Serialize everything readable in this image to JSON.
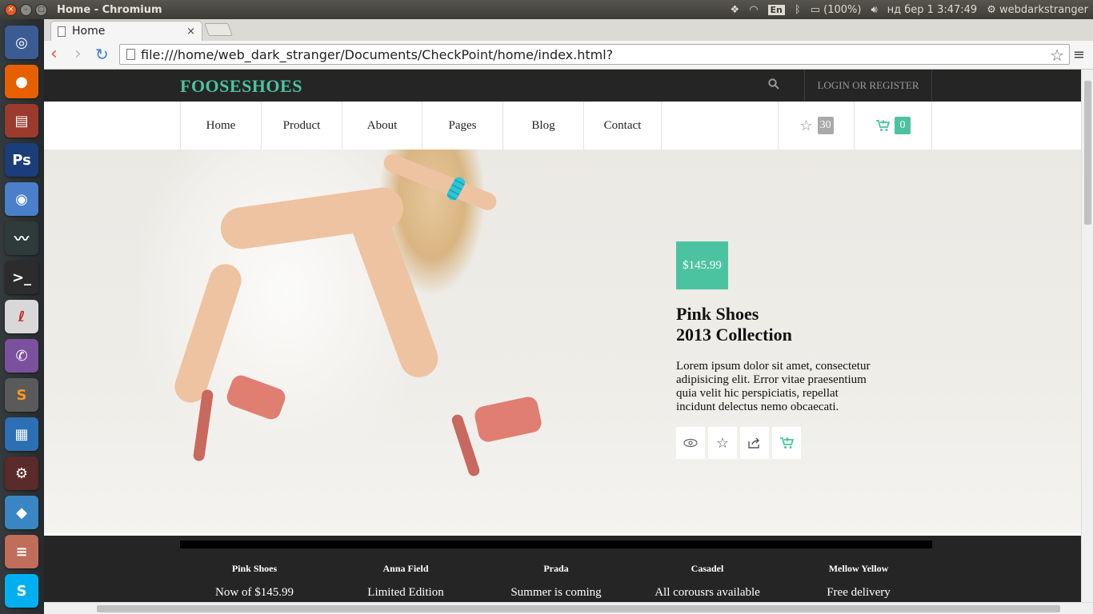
{
  "os": {
    "window_title": "Home - Chromium",
    "tray": {
      "lang": "En",
      "battery": "(100%)",
      "datetime": "нд бер  1  3:47:49",
      "user": "webdarkstranger"
    }
  },
  "browser": {
    "tab_title": "Home",
    "tab_close": "×",
    "url": "file:///home/web_dark_stranger/Documents/CheckPoint/home/index.html?"
  },
  "launcher": {
    "items": [
      {
        "name": "ubuntu",
        "color": "#3b5b93"
      },
      {
        "name": "firefox",
        "color": "#e66000"
      },
      {
        "name": "files",
        "color": "#9b3b2e"
      },
      {
        "name": "photoshop",
        "color": "#1b3e7a",
        "label": "Ps"
      },
      {
        "name": "chromium",
        "color": "#4a80c9"
      },
      {
        "name": "system-monitor",
        "color": "#2f3a3a"
      },
      {
        "name": "terminal",
        "color": "#2c2c2c"
      },
      {
        "name": "evince",
        "color": "#d8d8d8"
      },
      {
        "name": "viber",
        "color": "#7b519d"
      },
      {
        "name": "sublime",
        "color": "#5a5a5a"
      },
      {
        "name": "libreoffice-writer",
        "color": "#2c6fb3"
      },
      {
        "name": "settings",
        "color": "#5b2a2a"
      },
      {
        "name": "app",
        "color": "#3a86c4"
      },
      {
        "name": "mixer",
        "color": "#c06d5a"
      },
      {
        "name": "skype",
        "color": "#00aff0"
      }
    ]
  },
  "site": {
    "logo": "FOOSESHOES",
    "login": "LOGIN OR REGISTER",
    "accent": "#4cc3a0",
    "nav": [
      "Home",
      "Product",
      "About",
      "Pages",
      "Blog",
      "Contact"
    ],
    "wishlist_count": "30",
    "cart_count": "0"
  },
  "hero": {
    "price": "$145.99",
    "title_line1": "Pink Shoes",
    "title_line2": "2013 Collection",
    "text": "Lorem ipsum dolor sit amet, consectetur adipisicing elit. Error vitae praesentium quia velit hic perspiciatis, repellat incidunt delectus nemo obcaecati.",
    "actions": [
      "eye-icon",
      "star-icon",
      "share-icon",
      "cart-icon"
    ]
  },
  "strip": {
    "items": [
      {
        "heading": "Pink Shoes",
        "sub": "Now of $145.99"
      },
      {
        "heading": "Anna Field",
        "sub": "Limited Edition"
      },
      {
        "heading": "Prada",
        "sub": "Summer is coming"
      },
      {
        "heading": "Casadel",
        "sub": "All corousrs available"
      },
      {
        "heading": "Mellow Yellow",
        "sub": "Free delivery"
      }
    ]
  }
}
